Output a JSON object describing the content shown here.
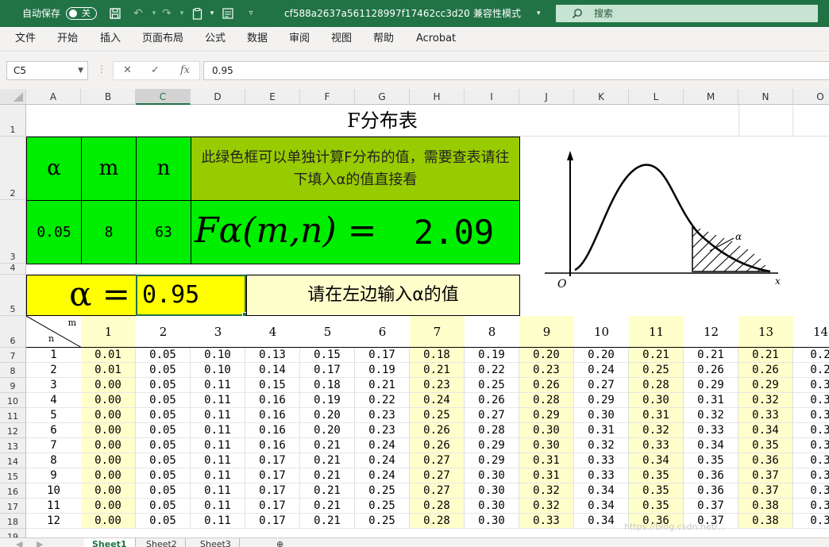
{
  "titlebar": {
    "autosave_label": "自动保存",
    "autosave_state": "关",
    "filename": "cf588a2637a561128997f17462cc3d20",
    "mode": "兼容性模式",
    "search_placeholder": "搜索"
  },
  "menu": [
    "文件",
    "开始",
    "插入",
    "页面布局",
    "公式",
    "数据",
    "审阅",
    "视图",
    "帮助",
    "Acrobat"
  ],
  "formula_bar": {
    "name_box": "C5",
    "cancel": "✕",
    "confirm": "✓",
    "fx": "fx",
    "value": "0.95"
  },
  "columns": [
    "A",
    "B",
    "C",
    "D",
    "E",
    "F",
    "G",
    "H",
    "I",
    "J",
    "K",
    "L",
    "M",
    "N",
    "O"
  ],
  "rows": [
    "1",
    "2",
    "3",
    "4",
    "5",
    "6",
    "7",
    "8",
    "9",
    "10",
    "11",
    "12",
    "13",
    "14",
    "15",
    "16",
    "17",
    "18",
    "19"
  ],
  "sheet": {
    "title": "F分布表",
    "alpha_label": "α",
    "m_label": "m",
    "n_label": "n",
    "note": "此绿色框可以单独计算F分布的值，需要查表请往下填入α的值直接看",
    "alpha_value": "0.05",
    "m_value": "8",
    "n_value": "63",
    "formula_label": "Fα(m,n) =",
    "formula_result": "2.09",
    "alpha_eq": "α =",
    "alpha_input": "0.95",
    "alpha_prompt": "请在左边输入α的值",
    "corner_m": "m",
    "corner_n": "n",
    "col_headers": [
      "1",
      "2",
      "3",
      "4",
      "5",
      "6",
      "7",
      "8",
      "9",
      "10",
      "11",
      "12",
      "13",
      "14"
    ],
    "row_labels": [
      "1",
      "2",
      "3",
      "4",
      "5",
      "6",
      "7",
      "8",
      "9",
      "10",
      "11",
      "12"
    ],
    "table": [
      [
        "0.01",
        "0.05",
        "0.10",
        "0.13",
        "0.15",
        "0.17",
        "0.18",
        "0.19",
        "0.20",
        "0.20",
        "0.21",
        "0.21",
        "0.21",
        "0.2"
      ],
      [
        "0.01",
        "0.05",
        "0.10",
        "0.14",
        "0.17",
        "0.19",
        "0.21",
        "0.22",
        "0.23",
        "0.24",
        "0.25",
        "0.26",
        "0.26",
        "0.2"
      ],
      [
        "0.00",
        "0.05",
        "0.11",
        "0.15",
        "0.18",
        "0.21",
        "0.23",
        "0.25",
        "0.26",
        "0.27",
        "0.28",
        "0.29",
        "0.29",
        "0.3"
      ],
      [
        "0.00",
        "0.05",
        "0.11",
        "0.16",
        "0.19",
        "0.22",
        "0.24",
        "0.26",
        "0.28",
        "0.29",
        "0.30",
        "0.31",
        "0.32",
        "0.3"
      ],
      [
        "0.00",
        "0.05",
        "0.11",
        "0.16",
        "0.20",
        "0.23",
        "0.25",
        "0.27",
        "0.29",
        "0.30",
        "0.31",
        "0.32",
        "0.33",
        "0.3"
      ],
      [
        "0.00",
        "0.05",
        "0.11",
        "0.16",
        "0.20",
        "0.23",
        "0.26",
        "0.28",
        "0.30",
        "0.31",
        "0.32",
        "0.33",
        "0.34",
        "0.3"
      ],
      [
        "0.00",
        "0.05",
        "0.11",
        "0.16",
        "0.21",
        "0.24",
        "0.26",
        "0.29",
        "0.30",
        "0.32",
        "0.33",
        "0.34",
        "0.35",
        "0.3"
      ],
      [
        "0.00",
        "0.05",
        "0.11",
        "0.17",
        "0.21",
        "0.24",
        "0.27",
        "0.29",
        "0.31",
        "0.33",
        "0.34",
        "0.35",
        "0.36",
        "0.3"
      ],
      [
        "0.00",
        "0.05",
        "0.11",
        "0.17",
        "0.21",
        "0.24",
        "0.27",
        "0.30",
        "0.31",
        "0.33",
        "0.35",
        "0.36",
        "0.37",
        "0.3"
      ],
      [
        "0.00",
        "0.05",
        "0.11",
        "0.17",
        "0.21",
        "0.25",
        "0.27",
        "0.30",
        "0.32",
        "0.34",
        "0.35",
        "0.36",
        "0.37",
        "0.3"
      ],
      [
        "0.00",
        "0.05",
        "0.11",
        "0.17",
        "0.21",
        "0.25",
        "0.28",
        "0.30",
        "0.32",
        "0.34",
        "0.35",
        "0.37",
        "0.38",
        "0.3"
      ],
      [
        "0.00",
        "0.05",
        "0.11",
        "0.17",
        "0.21",
        "0.25",
        "0.28",
        "0.30",
        "0.33",
        "0.34",
        "0.36",
        "0.37",
        "0.38",
        "0.3"
      ]
    ],
    "chart_labels": {
      "alpha": "α",
      "origin": "O",
      "x_axis": "x"
    }
  },
  "tabs": [
    "Sheet1",
    "Sheet2",
    "Sheet3"
  ],
  "colors": {
    "excel_green": "#217346",
    "bright_green": "#00ee00",
    "olive": "#99cc00",
    "yellow": "#ffff00",
    "light_yellow": "#ffffcc"
  }
}
